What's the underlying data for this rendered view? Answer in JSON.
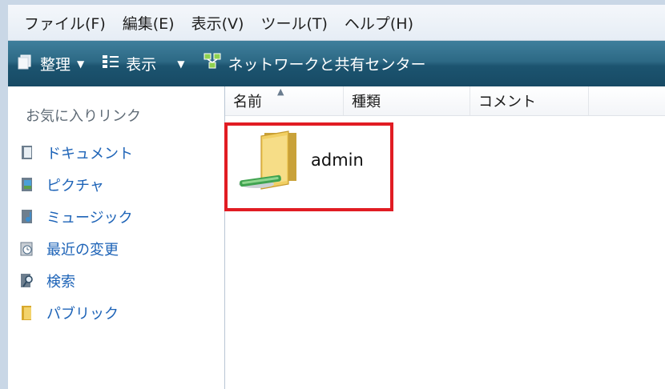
{
  "menu": [
    "ファイル(F)",
    "編集(E)",
    "表示(V)",
    "ツール(T)",
    "ヘルプ(H)"
  ],
  "toolbar": {
    "organize": "整理",
    "view": "表示",
    "network_center": "ネットワークと共有センター"
  },
  "sidebar": {
    "heading": "お気に入りリンク",
    "items": [
      {
        "label": "ドキュメント",
        "icon": "document-icon"
      },
      {
        "label": "ピクチャ",
        "icon": "pictures-icon"
      },
      {
        "label": "ミュージック",
        "icon": "music-icon"
      },
      {
        "label": "最近の変更",
        "icon": "recent-icon"
      },
      {
        "label": "検索",
        "icon": "search-icon"
      },
      {
        "label": "パブリック",
        "icon": "public-folder-icon"
      }
    ]
  },
  "columns": [
    "名前",
    "種類",
    "コメント"
  ],
  "items": [
    {
      "name": "admin",
      "icon": "shared-folder-icon"
    }
  ],
  "colors": {
    "toolbar": "#1c5470",
    "link": "#1d63b7",
    "highlight": "#e11c23"
  }
}
